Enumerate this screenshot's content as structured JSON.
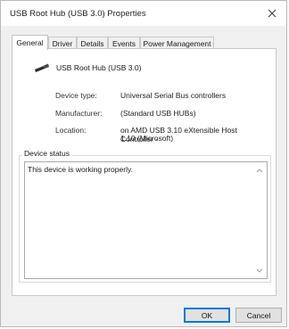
{
  "window": {
    "title": "USB Root Hub (USB 3.0) Properties"
  },
  "tabs": [
    {
      "label": "General",
      "active": true
    },
    {
      "label": "Driver",
      "active": false
    },
    {
      "label": "Details",
      "active": false
    },
    {
      "label": "Events",
      "active": false
    },
    {
      "label": "Power Management",
      "active": false
    }
  ],
  "device": {
    "icon": "usb-plug-icon",
    "name": "USB Root Hub (USB 3.0)"
  },
  "properties": {
    "device_type_label": "Device type:",
    "device_type_value": "Universal Serial Bus controllers",
    "manufacturer_label": "Manufacturer:",
    "manufacturer_value": "(Standard USB HUBs)",
    "location_label": "Location:",
    "location_value_line1": "on AMD USB 3.10 eXtensible Host Controller -",
    "location_value_line2": "1.10 (Microsoft)"
  },
  "status": {
    "group_label": "Device status",
    "text": "This device is working properly."
  },
  "buttons": {
    "ok": "OK",
    "cancel": "Cancel"
  },
  "colors": {
    "accent": "#0078d7",
    "left_edge_accent": "#22b14c"
  }
}
